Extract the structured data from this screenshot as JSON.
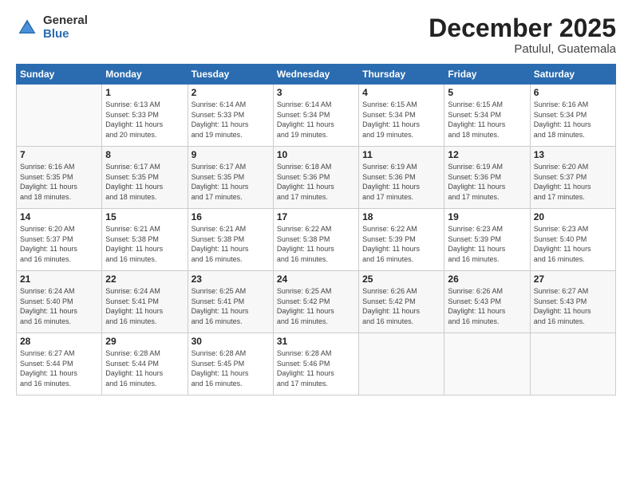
{
  "logo": {
    "general": "General",
    "blue": "Blue"
  },
  "title": "December 2025",
  "subtitle": "Patulul, Guatemala",
  "days_of_week": [
    "Sunday",
    "Monday",
    "Tuesday",
    "Wednesday",
    "Thursday",
    "Friday",
    "Saturday"
  ],
  "weeks": [
    [
      {
        "day": "",
        "info": ""
      },
      {
        "day": "1",
        "info": "Sunrise: 6:13 AM\nSunset: 5:33 PM\nDaylight: 11 hours\nand 20 minutes."
      },
      {
        "day": "2",
        "info": "Sunrise: 6:14 AM\nSunset: 5:33 PM\nDaylight: 11 hours\nand 19 minutes."
      },
      {
        "day": "3",
        "info": "Sunrise: 6:14 AM\nSunset: 5:34 PM\nDaylight: 11 hours\nand 19 minutes."
      },
      {
        "day": "4",
        "info": "Sunrise: 6:15 AM\nSunset: 5:34 PM\nDaylight: 11 hours\nand 19 minutes."
      },
      {
        "day": "5",
        "info": "Sunrise: 6:15 AM\nSunset: 5:34 PM\nDaylight: 11 hours\nand 18 minutes."
      },
      {
        "day": "6",
        "info": "Sunrise: 6:16 AM\nSunset: 5:34 PM\nDaylight: 11 hours\nand 18 minutes."
      }
    ],
    [
      {
        "day": "7",
        "info": "Sunrise: 6:16 AM\nSunset: 5:35 PM\nDaylight: 11 hours\nand 18 minutes."
      },
      {
        "day": "8",
        "info": "Sunrise: 6:17 AM\nSunset: 5:35 PM\nDaylight: 11 hours\nand 18 minutes."
      },
      {
        "day": "9",
        "info": "Sunrise: 6:17 AM\nSunset: 5:35 PM\nDaylight: 11 hours\nand 17 minutes."
      },
      {
        "day": "10",
        "info": "Sunrise: 6:18 AM\nSunset: 5:36 PM\nDaylight: 11 hours\nand 17 minutes."
      },
      {
        "day": "11",
        "info": "Sunrise: 6:19 AM\nSunset: 5:36 PM\nDaylight: 11 hours\nand 17 minutes."
      },
      {
        "day": "12",
        "info": "Sunrise: 6:19 AM\nSunset: 5:36 PM\nDaylight: 11 hours\nand 17 minutes."
      },
      {
        "day": "13",
        "info": "Sunrise: 6:20 AM\nSunset: 5:37 PM\nDaylight: 11 hours\nand 17 minutes."
      }
    ],
    [
      {
        "day": "14",
        "info": "Sunrise: 6:20 AM\nSunset: 5:37 PM\nDaylight: 11 hours\nand 16 minutes."
      },
      {
        "day": "15",
        "info": "Sunrise: 6:21 AM\nSunset: 5:38 PM\nDaylight: 11 hours\nand 16 minutes."
      },
      {
        "day": "16",
        "info": "Sunrise: 6:21 AM\nSunset: 5:38 PM\nDaylight: 11 hours\nand 16 minutes."
      },
      {
        "day": "17",
        "info": "Sunrise: 6:22 AM\nSunset: 5:38 PM\nDaylight: 11 hours\nand 16 minutes."
      },
      {
        "day": "18",
        "info": "Sunrise: 6:22 AM\nSunset: 5:39 PM\nDaylight: 11 hours\nand 16 minutes."
      },
      {
        "day": "19",
        "info": "Sunrise: 6:23 AM\nSunset: 5:39 PM\nDaylight: 11 hours\nand 16 minutes."
      },
      {
        "day": "20",
        "info": "Sunrise: 6:23 AM\nSunset: 5:40 PM\nDaylight: 11 hours\nand 16 minutes."
      }
    ],
    [
      {
        "day": "21",
        "info": "Sunrise: 6:24 AM\nSunset: 5:40 PM\nDaylight: 11 hours\nand 16 minutes."
      },
      {
        "day": "22",
        "info": "Sunrise: 6:24 AM\nSunset: 5:41 PM\nDaylight: 11 hours\nand 16 minutes."
      },
      {
        "day": "23",
        "info": "Sunrise: 6:25 AM\nSunset: 5:41 PM\nDaylight: 11 hours\nand 16 minutes."
      },
      {
        "day": "24",
        "info": "Sunrise: 6:25 AM\nSunset: 5:42 PM\nDaylight: 11 hours\nand 16 minutes."
      },
      {
        "day": "25",
        "info": "Sunrise: 6:26 AM\nSunset: 5:42 PM\nDaylight: 11 hours\nand 16 minutes."
      },
      {
        "day": "26",
        "info": "Sunrise: 6:26 AM\nSunset: 5:43 PM\nDaylight: 11 hours\nand 16 minutes."
      },
      {
        "day": "27",
        "info": "Sunrise: 6:27 AM\nSunset: 5:43 PM\nDaylight: 11 hours\nand 16 minutes."
      }
    ],
    [
      {
        "day": "28",
        "info": "Sunrise: 6:27 AM\nSunset: 5:44 PM\nDaylight: 11 hours\nand 16 minutes."
      },
      {
        "day": "29",
        "info": "Sunrise: 6:28 AM\nSunset: 5:44 PM\nDaylight: 11 hours\nand 16 minutes."
      },
      {
        "day": "30",
        "info": "Sunrise: 6:28 AM\nSunset: 5:45 PM\nDaylight: 11 hours\nand 16 minutes."
      },
      {
        "day": "31",
        "info": "Sunrise: 6:28 AM\nSunset: 5:46 PM\nDaylight: 11 hours\nand 17 minutes."
      },
      {
        "day": "",
        "info": ""
      },
      {
        "day": "",
        "info": ""
      },
      {
        "day": "",
        "info": ""
      }
    ]
  ]
}
